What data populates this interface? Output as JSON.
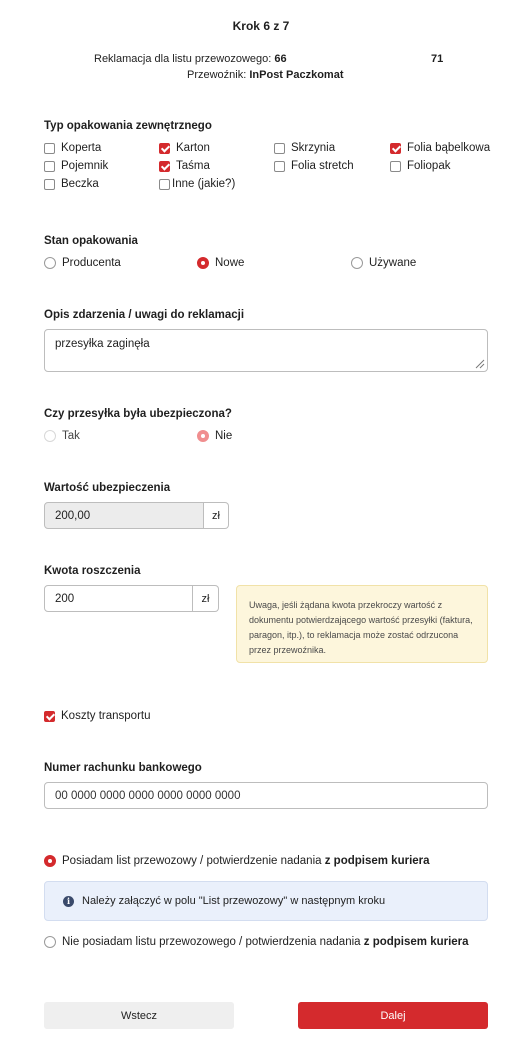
{
  "step": "Krok 6 z 7",
  "header": {
    "complaint_prefix": "Reklamacja dla listu przewozowego: ",
    "waybill_visible": "66",
    "waybill_tail": "71",
    "carrier_prefix": "Przewoźnik: ",
    "carrier_name": "InPost Paczkomat"
  },
  "packaging": {
    "title": "Typ opakowania zewnętrznego",
    "options": [
      {
        "label": "Koperta",
        "checked": false
      },
      {
        "label": "Karton",
        "checked": true
      },
      {
        "label": "Skrzynia",
        "checked": false
      },
      {
        "label": "Folia bąbelkowa",
        "checked": true
      },
      {
        "label": "Pojemnik",
        "checked": false
      },
      {
        "label": "Taśma",
        "checked": true
      },
      {
        "label": "Folia stretch",
        "checked": false
      },
      {
        "label": "Foliopak",
        "checked": false
      },
      {
        "label": "Beczka",
        "checked": false
      },
      {
        "label": "Inne (jakie?)",
        "checked": false
      }
    ]
  },
  "condition": {
    "title": "Stan opakowania",
    "options": [
      {
        "label": "Producenta",
        "selected": false
      },
      {
        "label": "Nowe",
        "selected": true
      },
      {
        "label": "Używane",
        "selected": false
      }
    ]
  },
  "description": {
    "title": "Opis zdarzenia / uwagi do reklamacji",
    "value": "przesyłka zaginęła"
  },
  "insured": {
    "title": "Czy przesyłka była ubezpieczona?",
    "options": [
      {
        "label": "Tak",
        "selected": false
      },
      {
        "label": "Nie",
        "selected": true
      }
    ]
  },
  "insurance_value": {
    "title": "Wartość ubezpieczenia",
    "value": "200,00",
    "unit": "zł"
  },
  "claim_amount": {
    "title": "Kwota roszczenia",
    "value": "200",
    "unit": "zł",
    "warning": "Uwaga, jeśli żądana kwota przekroczy wartość z dokumentu potwierdzającego wartość przesyłki (faktura, paragon, itp.), to reklamacja może zostać odrzucona przez przewoźnika."
  },
  "transport_costs": {
    "label": "Koszty transportu",
    "checked": true
  },
  "bank_account": {
    "title": "Numer rachunku bankowego",
    "placeholder": "00 0000 0000 0000 0000 0000 0000"
  },
  "waybill_doc": {
    "has_label_prefix": "Posiadam list przewozowy / potwierdzenie nadania ",
    "has_label_bold": "z podpisem kuriera",
    "has_selected": true,
    "info": "Należy załączyć w polu \"List przewozowy\" w następnym kroku",
    "not_label_prefix": "Nie posiadam listu przewozowego / potwierdzenia nadania ",
    "not_label_bold": "z podpisem kuriera",
    "not_selected": false
  },
  "buttons": {
    "back": "Wstecz",
    "next": "Dalej"
  },
  "colors": {
    "accent": "#d42a2d",
    "warning_bg": "#fdf6dc",
    "info_bg": "#eaf0fb"
  }
}
